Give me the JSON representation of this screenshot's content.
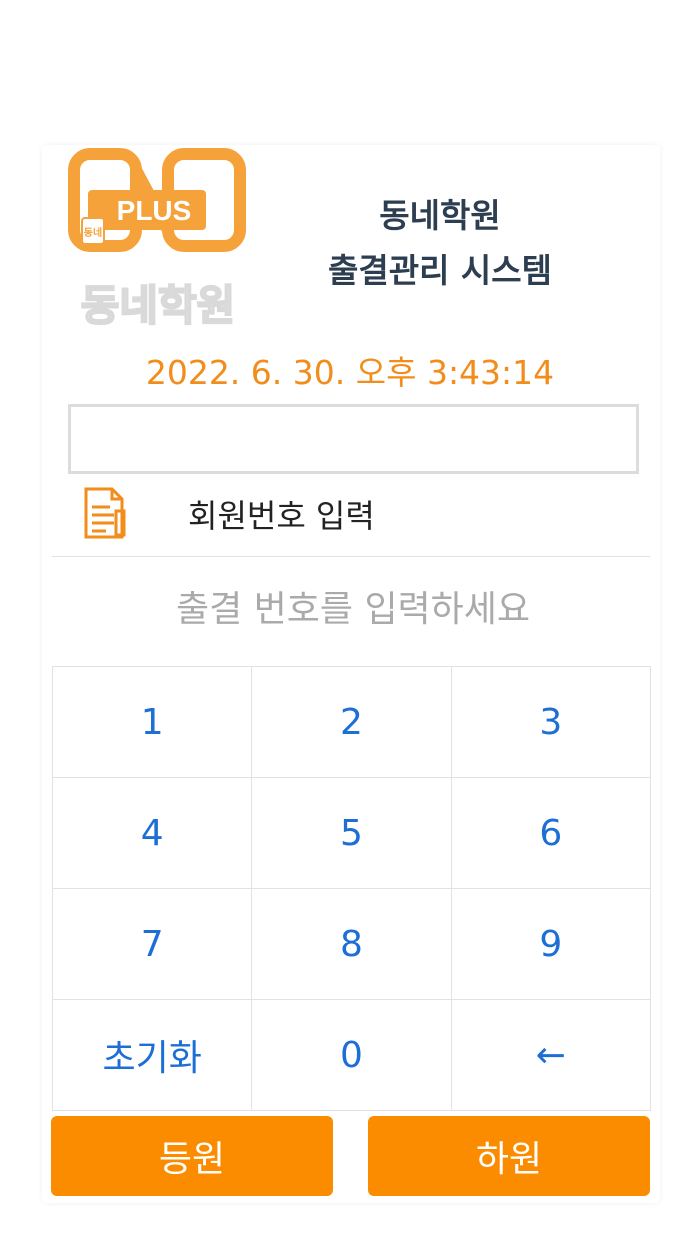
{
  "brand": {
    "logo_text": "동네학원",
    "logo_badge": "PLUS",
    "logo_mini": "동네",
    "accent_color": "#f28c1b"
  },
  "header": {
    "title_line1": "동네학원",
    "title_line2": "출결관리 시스템"
  },
  "datetime": "2022. 6. 30. 오후 3:43:14",
  "member_input": {
    "icon": "document-icon",
    "label": "회원번호 입력",
    "value": ""
  },
  "attendance": {
    "placeholder": "출결 번호를 입력하세요",
    "value": ""
  },
  "keypad": {
    "keys": [
      "1",
      "2",
      "3",
      "4",
      "5",
      "6",
      "7",
      "8",
      "9",
      "초기화",
      "0",
      "←"
    ],
    "key_color": "#1d6fd6"
  },
  "actions": {
    "check_in_label": "등원",
    "check_out_label": "하원",
    "button_color": "#fb8c00"
  }
}
